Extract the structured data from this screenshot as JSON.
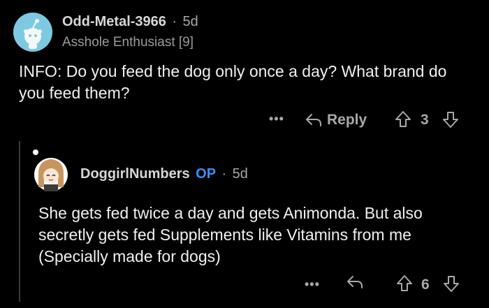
{
  "comment": {
    "username": "Odd-Metal-3966",
    "separator": "·",
    "age": "5d",
    "flair": "Asshole Enthusiast [9]",
    "text": "INFO: Do you feed the dog only once a day? What brand do you feed them?",
    "actions": {
      "more": "•••",
      "reply_label": "Reply",
      "score": "3"
    }
  },
  "reply": {
    "username": "DoggirlNumbers",
    "op_badge": "OP",
    "separator": "·",
    "age": "5d",
    "text": "She gets fed twice a day and gets Animonda. But also secretly gets fed Supplements like Vitamins from me (Specially made for dogs)",
    "actions": {
      "more": "•••",
      "score": "6"
    }
  },
  "colors": {
    "background": "#000000",
    "avatar_bg": "#7ec9e2",
    "op_badge": "#3a8fff",
    "thread_line": "#3a3a3a"
  }
}
